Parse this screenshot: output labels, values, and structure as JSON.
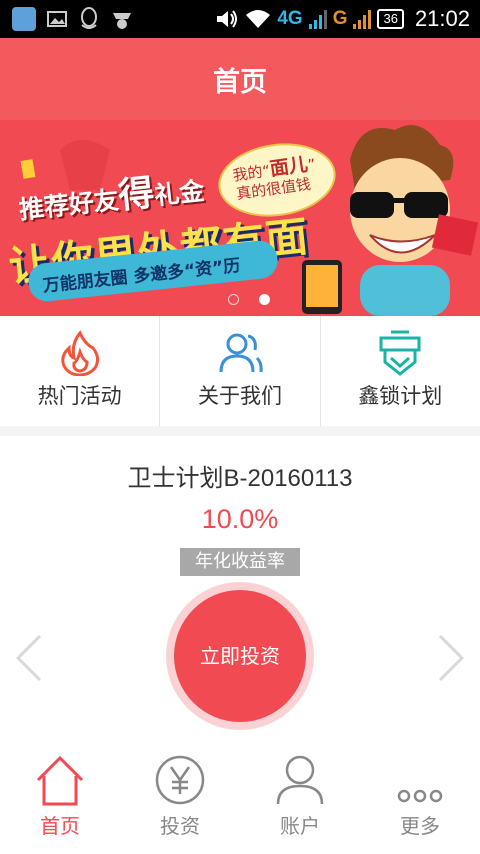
{
  "status_bar": {
    "network_4g": "4G",
    "network_g": "G",
    "battery": "36",
    "time": "21:02"
  },
  "header": {
    "title": "首页"
  },
  "banner": {
    "line1_a": "推荐好友",
    "line1_b": "得",
    "line1_c": "礼金",
    "line2": "让你里外都有面",
    "line3": "万能朋友圈  多邀多“资”历",
    "speech_line1_a": "我的“",
    "speech_line1_b": "面儿",
    "speech_line1_c": "”",
    "speech_line2": "真的很值钱",
    "page_count": 2,
    "active_page": 1
  },
  "quick_menu": {
    "items": [
      {
        "label": "热门活动",
        "icon": "flame-icon"
      },
      {
        "label": "关于我们",
        "icon": "users-icon"
      },
      {
        "label": "鑫锁计划",
        "icon": "shield-badge-icon"
      }
    ]
  },
  "product": {
    "name": "卫士计划B-20160113",
    "rate": "10.0%",
    "rate_label": "年化收益率",
    "invest_label": "立即投资"
  },
  "bottom_nav": {
    "items": [
      {
        "label": "首页",
        "icon": "home-icon",
        "active": true
      },
      {
        "label": "投资",
        "icon": "yen-icon",
        "active": false
      },
      {
        "label": "账户",
        "icon": "person-icon",
        "active": false
      },
      {
        "label": "更多",
        "icon": "more-dots-icon",
        "active": false
      }
    ]
  },
  "colors": {
    "primary": "#f25a5e",
    "accent_red": "#f24a52",
    "teal": "#1bb3a8",
    "blue": "#3a8fd6"
  }
}
